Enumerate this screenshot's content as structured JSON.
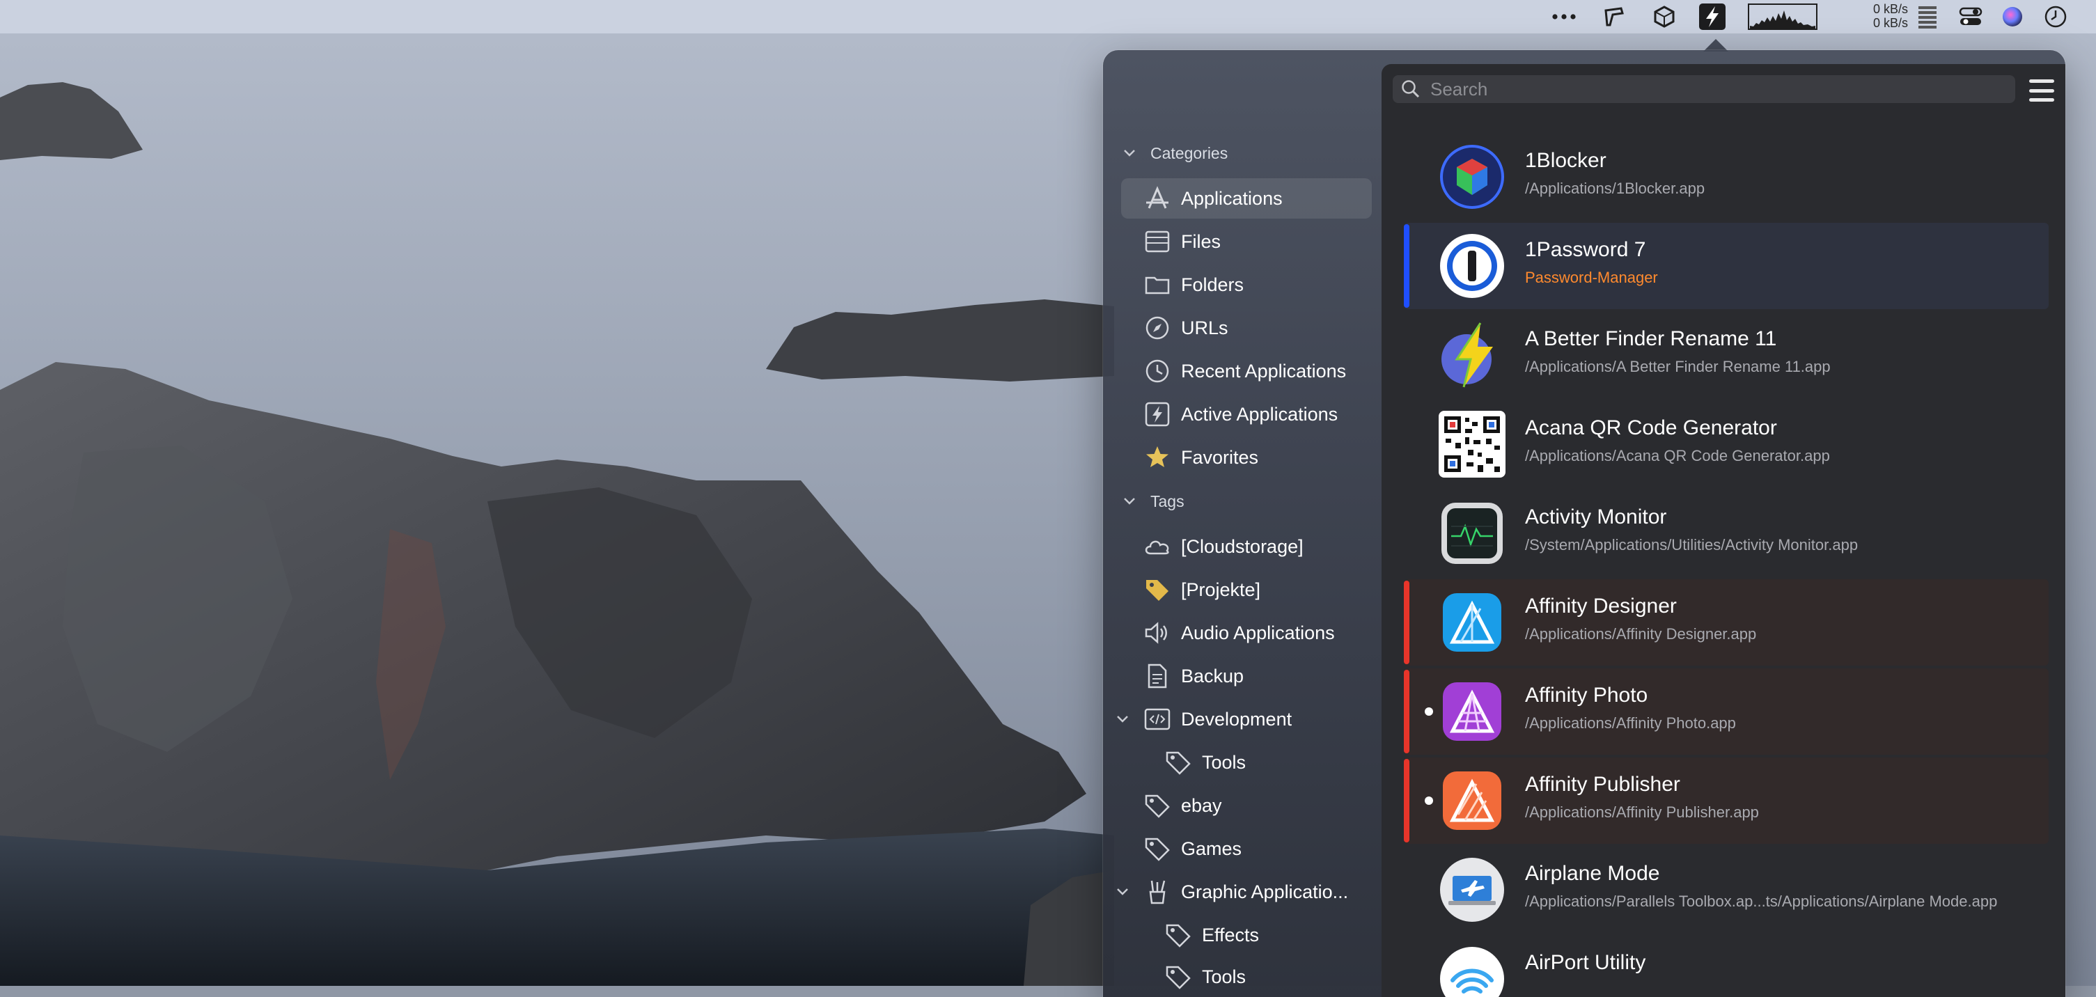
{
  "menubar": {
    "net_up": "0 kB/s",
    "net_down": "0 kB/s",
    "icons": [
      "ellipsis-icon",
      "stack-icon",
      "cube-icon",
      "lightning-icon",
      "activity-graph-icon",
      "memory-icon",
      "control-center-icon",
      "siri-icon",
      "clock-icon"
    ]
  },
  "sidebar": {
    "categories_header": "Categories",
    "categories": [
      {
        "label": "Applications",
        "icon": "applications-icon"
      },
      {
        "label": "Files",
        "icon": "files-icon"
      },
      {
        "label": "Folders",
        "icon": "folder-icon"
      },
      {
        "label": "URLs",
        "icon": "compass-icon"
      },
      {
        "label": "Recent Applications",
        "icon": "clock-icon"
      },
      {
        "label": "Active Applications",
        "icon": "lightning-icon"
      },
      {
        "label": "Favorites",
        "icon": "star-icon"
      }
    ],
    "tags_header": "Tags",
    "tags": [
      {
        "label": "[Cloudstorage]",
        "icon": "cloud-icon"
      },
      {
        "label": "[Projekte]",
        "icon": "tag-icon"
      },
      {
        "label": "Audio Applications",
        "icon": "speaker-icon"
      },
      {
        "label": "Backup",
        "icon": "document-icon"
      },
      {
        "label": "Development",
        "icon": "code-icon"
      },
      {
        "label": "Tools",
        "icon": "tag-icon"
      },
      {
        "label": "ebay",
        "icon": "tag-icon"
      },
      {
        "label": "Games",
        "icon": "tag-icon"
      },
      {
        "label": "Graphic Applicatio...",
        "icon": "brush-icon"
      },
      {
        "label": "Effects",
        "icon": "tag-icon"
      },
      {
        "label": "Tools",
        "icon": "tag-icon"
      }
    ]
  },
  "search": {
    "placeholder": "Search",
    "value": ""
  },
  "apps": [
    {
      "name": "1Blocker",
      "path": "/Applications/1Blocker.app",
      "stripe": "",
      "dot": false,
      "icon": "1blocker-icon"
    },
    {
      "name": "1Password 7",
      "path": "Password-Manager",
      "stripe": "#1f4fff",
      "dot": false,
      "icon": "1password-icon"
    },
    {
      "name": "A Better Finder Rename 11",
      "path": "/Applications/A Better Finder Rename 11.app",
      "stripe": "",
      "dot": false,
      "icon": "finder-rename-icon"
    },
    {
      "name": "Acana QR Code Generator",
      "path": "/Applications/Acana QR Code Generator.app",
      "stripe": "",
      "dot": false,
      "icon": "qr-code-icon"
    },
    {
      "name": "Activity Monitor",
      "path": "/System/Applications/Utilities/Activity Monitor.app",
      "stripe": "",
      "dot": false,
      "icon": "activity-monitor-icon"
    },
    {
      "name": "Affinity Designer",
      "path": "/Applications/Affinity Designer.app",
      "stripe": "#e8352a",
      "dot": false,
      "icon": "affinity-designer-icon"
    },
    {
      "name": "Affinity Photo",
      "path": "/Applications/Affinity Photo.app",
      "stripe": "#e8352a",
      "dot": true,
      "icon": "affinity-photo-icon"
    },
    {
      "name": "Affinity Publisher",
      "path": "/Applications/Affinity Publisher.app",
      "stripe": "#e8352a",
      "dot": true,
      "icon": "affinity-publisher-icon"
    },
    {
      "name": "Airplane Mode",
      "path": "/Applications/Parallels Toolbox.ap...ts/Applications/Airplane Mode.app",
      "stripe": "",
      "dot": false,
      "icon": "airplane-mode-icon"
    },
    {
      "name": "AirPort Utility",
      "path": "",
      "stripe": "",
      "dot": false,
      "icon": "airport-utility-icon"
    }
  ],
  "colors": {
    "accent_blue": "#1f4fff",
    "tag_red": "#e8352a",
    "tag_row_tint": "#3a2a2a",
    "selected_row_tint": "#2e323f",
    "password_manager_text": "#ff8a2e"
  }
}
